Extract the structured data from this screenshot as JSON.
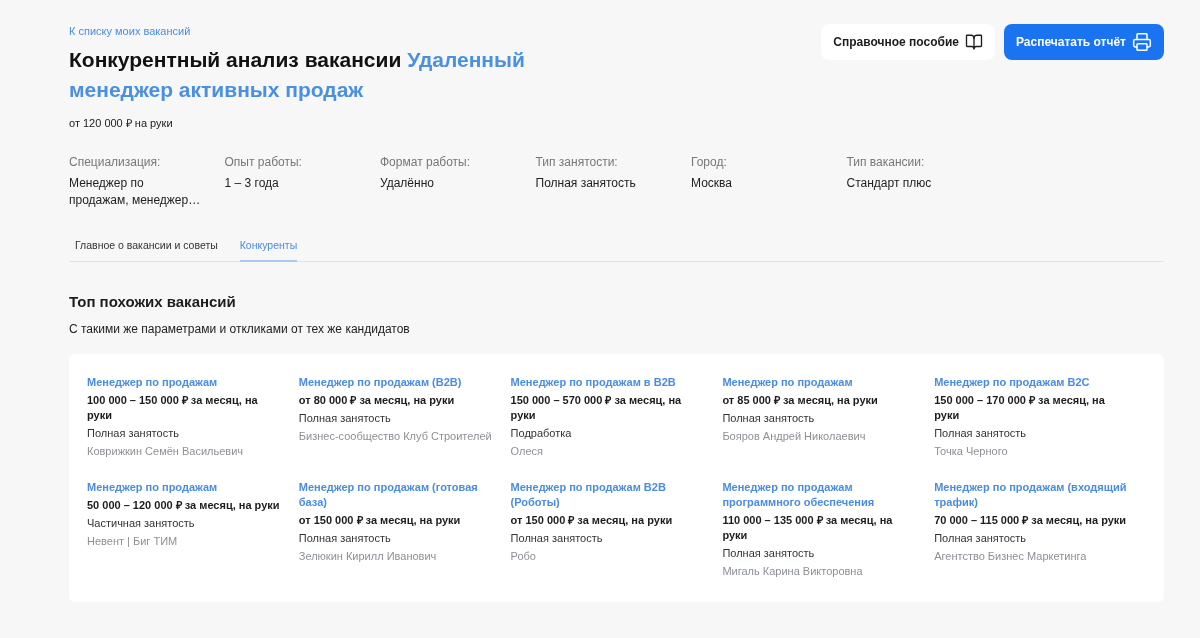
{
  "back_link": "К списку моих вакансий",
  "title": {
    "text": "Конкурентный анализ вакансии",
    "vacancy": "Удаленный менеджер активных продаж"
  },
  "salary": "от 120 000 ₽ на руки",
  "actions": [
    {
      "kind": "secondary",
      "label": "Справочное пособие"
    },
    {
      "kind": "primary",
      "label": "Распечатать отчёт"
    }
  ],
  "params": [
    {
      "label": "Специализация:",
      "value": "Менеджер по продажам, менеджер…"
    },
    {
      "label": "Опыт работы:",
      "value": "1 – 3 года"
    },
    {
      "label": "Формат работы:",
      "value": "Удалённо"
    },
    {
      "label": "Тип занятости:",
      "value": "Полная занятость"
    },
    {
      "label": "Город:",
      "value": "Москва"
    },
    {
      "label": "Тип вакансии:",
      "value": "Стандарт плюс"
    }
  ],
  "tabs": [
    {
      "label": "Главное о вакансии и советы",
      "selected": false
    },
    {
      "label": "Конкуренты",
      "selected": true
    }
  ],
  "section": {
    "title": "Топ похожих вакансий",
    "subtitle": "С такими же параметрами и откликами от тех же кандидатов"
  },
  "vacancies": [
    {
      "title": "Менеджер по продажам",
      "salary": "100 000 – 150 000 ₽ за месяц, на руки",
      "employment": "Полная занятость",
      "company": "Коврижкин Семён Васильевич"
    },
    {
      "title": "Менеджер по продажам (B2B)",
      "salary": "от 80 000 ₽ за месяц, на руки",
      "employment": "Полная занятость",
      "company": "Бизнес-сообщество Клуб Строителей"
    },
    {
      "title": "Менеджер по продажам в B2B",
      "salary": "150 000 – 570 000 ₽ за месяц, на руки",
      "employment": "Подработка",
      "company": "Олеся"
    },
    {
      "title": "Менеджер по продажам",
      "salary": "от 85 000 ₽ за месяц, на руки",
      "employment": "Полная занятость",
      "company": "Бояров Андрей Николаевич"
    },
    {
      "title": "Менеджер по продажам B2C",
      "salary": "150 000 – 170 000 ₽ за месяц, на руки",
      "employment": "Полная занятость",
      "company": "Точка Черного"
    },
    {
      "title": "Менеджер по продажам",
      "salary": "50 000 – 120 000 ₽ за месяц, на руки",
      "employment": "Частичная занятость",
      "company": "Невент | Биг ТИМ"
    },
    {
      "title": "Менеджер по продажам (готовая база)",
      "salary": "от 150 000 ₽ за месяц, на руки",
      "employment": "Полная занятость",
      "company": "Зелюкин Кирилл Иванович"
    },
    {
      "title": "Менеджер по продажам B2B (Роботы)",
      "salary": "от 150 000 ₽ за месяц, на руки",
      "employment": "Полная занятость",
      "company": "Робо"
    },
    {
      "title": "Менеджер по продажам программного обеспечения",
      "salary": "110 000 – 135 000 ₽ за месяц, на руки",
      "employment": "Полная занятость",
      "company": "Мигаль Карина Викторовна"
    },
    {
      "title": "Менеджер по продажам (входящий трафик)",
      "salary": "70 000 – 115 000 ₽ за месяц, на руки",
      "employment": "Полная занятость",
      "company": "Агентство Бизнес Маркетинга"
    }
  ]
}
